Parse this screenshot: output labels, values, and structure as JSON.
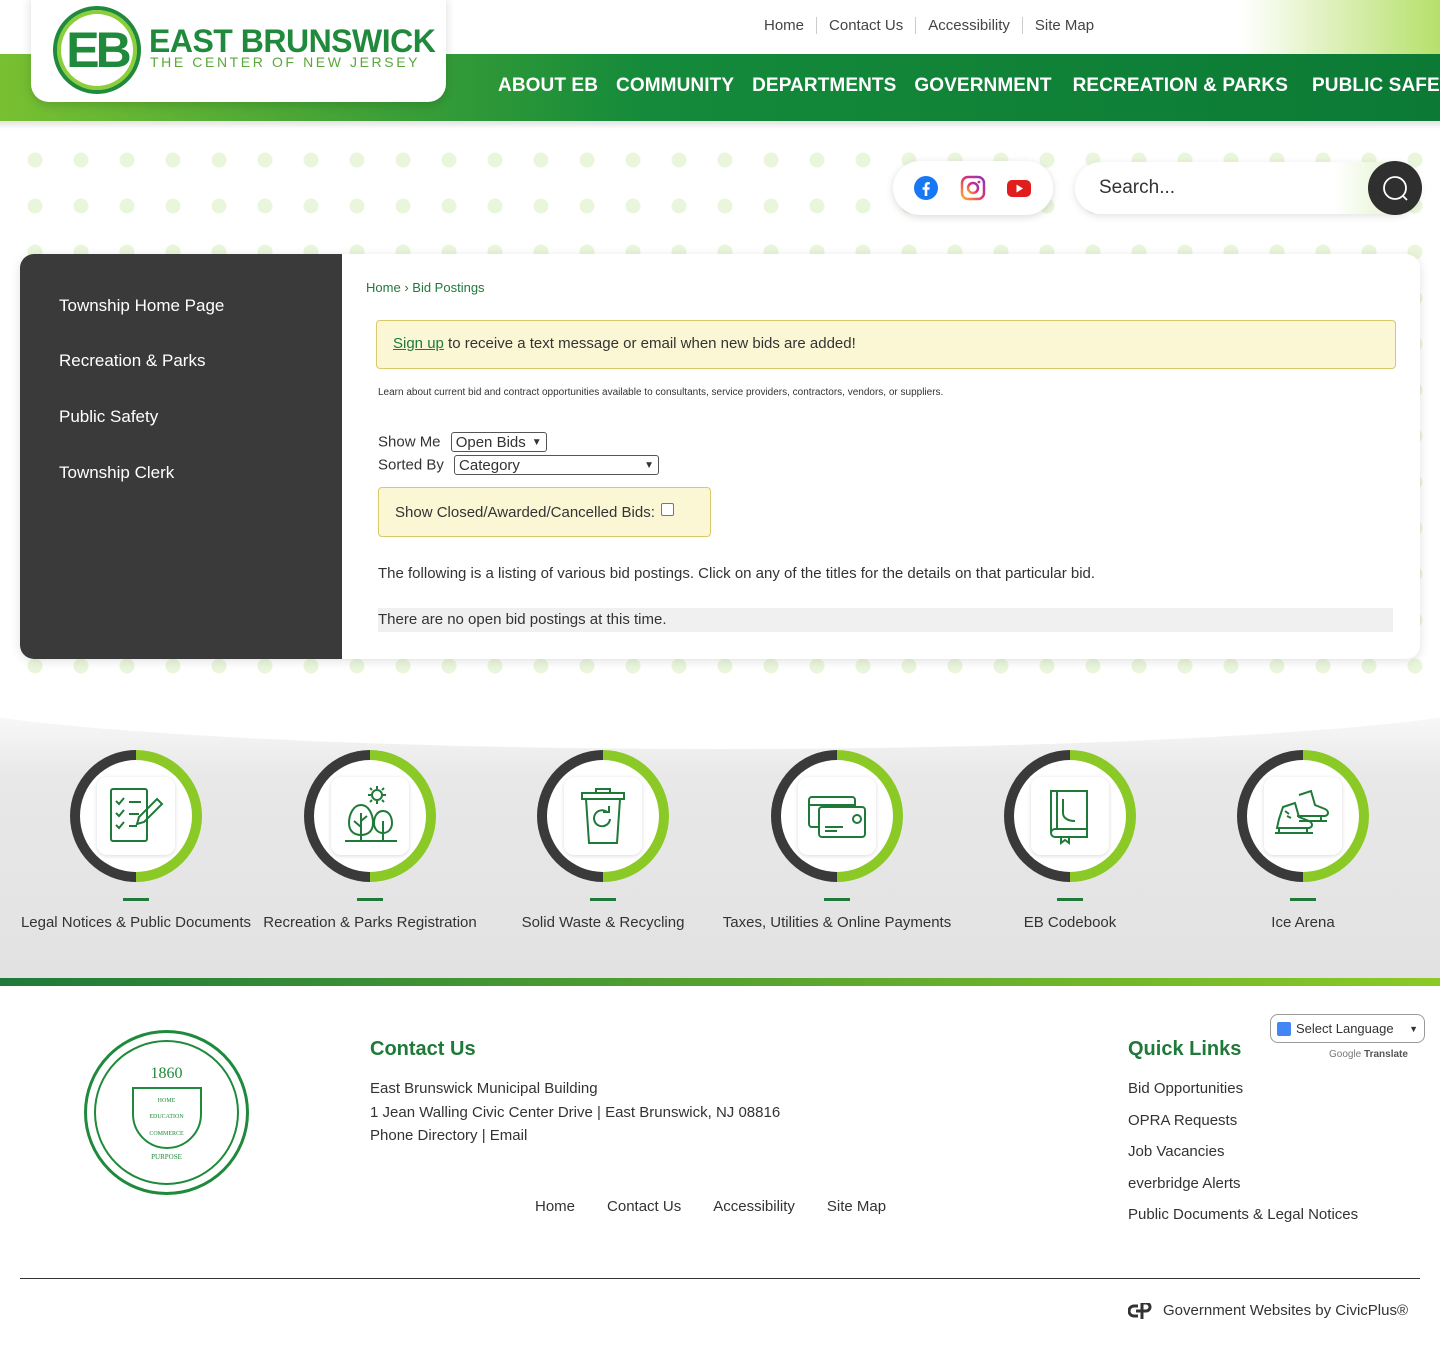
{
  "header": {
    "logo_mark": "EB",
    "logo_name": "EAST BRUNSWICK",
    "logo_tagline": "THE CENTER OF NEW JERSEY",
    "util_nav": [
      "Home",
      "Contact Us",
      "Accessibility",
      "Site Map"
    ],
    "main_nav": [
      "ABOUT EB",
      "COMMUNITY",
      "DEPARTMENTS",
      "GOVERNMENT",
      "RECREATION & PARKS",
      "PUBLIC SAFETY"
    ],
    "search_placeholder": "Search...",
    "social": [
      "facebook-icon",
      "instagram-icon",
      "youtube-icon"
    ]
  },
  "sidebar": {
    "items": [
      {
        "label": "Township Home Page"
      },
      {
        "label": "Recreation & Parks"
      },
      {
        "label": "Public Safety"
      },
      {
        "label": "Township Clerk"
      }
    ]
  },
  "main": {
    "breadcrumb_home": "Home",
    "breadcrumb_sep": "›",
    "breadcrumb_current": "Bid Postings",
    "alert_link": "Sign up",
    "alert_text": " to receive a text message or email when new bids are added!",
    "learn_text": "Learn about current bid and contract opportunities available to consultants, service providers, contractors, vendors, or suppliers.",
    "show_me_label": "Show Me",
    "show_me_value": "Open Bids",
    "sorted_by_label": "Sorted By",
    "sorted_by_value": "Category",
    "closed_label": "Show Closed/Awarded/Cancelled Bids:",
    "following_text": "The following is a listing of various bid postings. Click on any of the titles for the details on that particular bid.",
    "no_bids_text": "There are no open bid postings at this time."
  },
  "quick_icons": [
    {
      "label": "Legal Notices & Public Documents",
      "icon": "checklist-icon"
    },
    {
      "label": "Recreation & Parks Registration",
      "icon": "trees-icon"
    },
    {
      "label": "Solid Waste & Recycling",
      "icon": "recycle-bin-icon"
    },
    {
      "label": "Taxes, Utilities & Online Payments",
      "icon": "payment-card-icon"
    },
    {
      "label": "EB Codebook",
      "icon": "book-icon"
    },
    {
      "label": "Ice Arena",
      "icon": "ice-skates-icon"
    }
  ],
  "footer": {
    "seal_year": "1860",
    "seal_text_1": "HOME",
    "seal_text_2": "EDUCATION",
    "seal_text_3": "COMMERCE",
    "seal_text_4": "PURPOSE",
    "contact_heading": "Contact Us",
    "contact_lines": [
      "East Brunswick Municipal Building",
      "1 Jean Walling Civic Center Drive | East Brunswick, NJ 08816",
      "Phone Directory | Email"
    ],
    "nav": [
      "Home",
      "Contact Us",
      "Accessibility",
      "Site Map"
    ],
    "quick_heading": "Quick Links",
    "quick_links": [
      "Bid Opportunities",
      "OPRA Requests",
      "Job Vacancies",
      "everbridge Alerts",
      "Public Documents & Legal Notices"
    ],
    "language_select": "Select Language",
    "google_label": "Google",
    "translate_label": "Translate",
    "civicplus": "Government Websites by CivicPlus®"
  }
}
